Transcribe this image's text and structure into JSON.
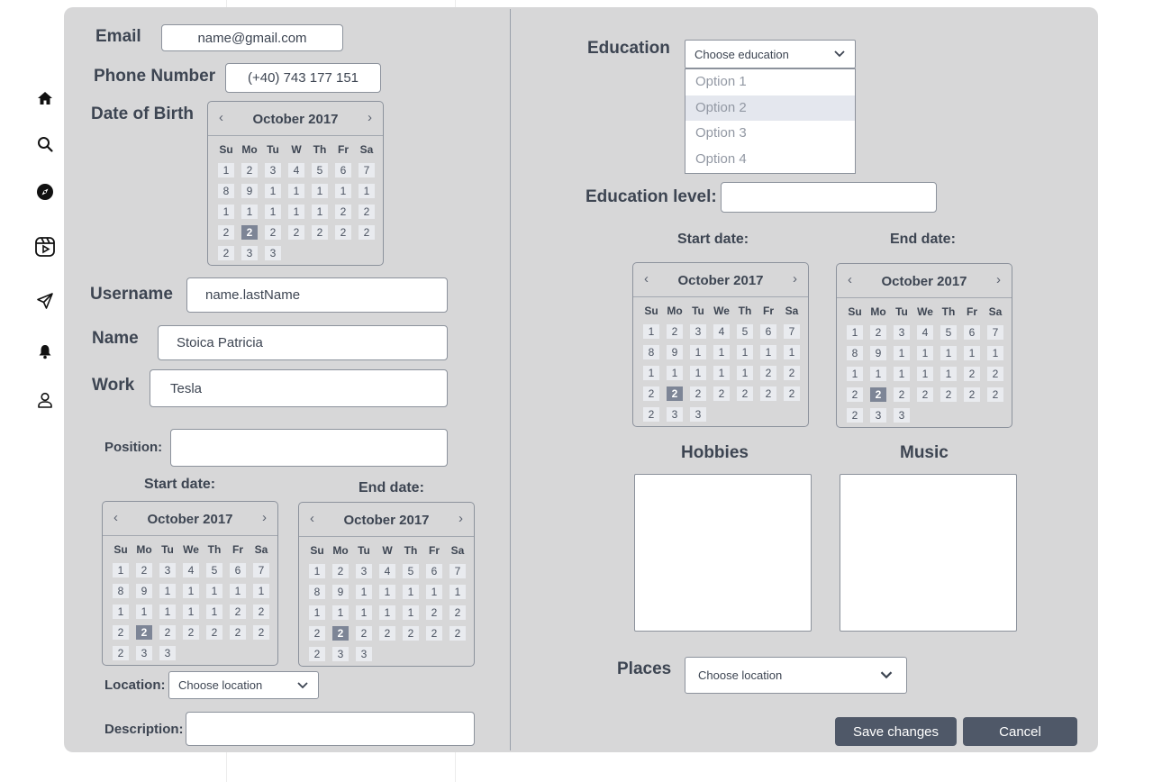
{
  "sidebar": {
    "icons": [
      "home-icon",
      "search-icon",
      "explore-icon",
      "reels-icon",
      "send-icon",
      "bell-icon",
      "profile-icon"
    ]
  },
  "form": {
    "email_label": "Email",
    "email_value": "name@gmail.com",
    "phone_label": "Phone Number",
    "phone_value": "(+40) 743 177 151",
    "dob_label": "Date of Birth",
    "username_label": "Username",
    "username_value": "name.lastName",
    "name_label": "Name",
    "name_value": "Stoica Patricia",
    "work_label": "Work",
    "work_value": "Tesla",
    "position_label": "Position:",
    "position_value": "",
    "start_date_label": "Start date:",
    "end_date_label": "End date:",
    "location_label": "Location:",
    "location_value": "Choose location",
    "description_label": "Description:",
    "description_value": "",
    "education_label": "Education",
    "education_value": "Choose education",
    "education_options": [
      "Option 1",
      "Option 2",
      "Option 3",
      "Option 4"
    ],
    "education_level_label": "Education level:",
    "education_level_value": "",
    "hobbies_label": "Hobbies",
    "music_label": "Music",
    "places_label": "Places",
    "places_value": "Choose location",
    "save_label": "Save changes",
    "cancel_label": "Cancel"
  },
  "calendar": {
    "title": "October 2017",
    "prev": "‹",
    "next": "›",
    "dows_short": [
      "Su",
      "Mo",
      "Tu",
      "W",
      "Th",
      "Fr",
      "Sa"
    ],
    "dows_long": [
      "Su",
      "Mo",
      "Tu",
      "We",
      "Th",
      "Fr",
      "Sa"
    ],
    "days": [
      "1",
      "2",
      "3",
      "4",
      "5",
      "6",
      "7",
      "8",
      "9",
      "1",
      "1",
      "1",
      "1",
      "1",
      "1",
      "1",
      "1",
      "1",
      "1",
      "2",
      "2",
      "2",
      "2",
      "2",
      "2",
      "2",
      "2",
      "2",
      "2",
      "3",
      "3"
    ],
    "selected_index": 22
  },
  "colors": {
    "panel": "#d7d7d8",
    "button": "#4f5868",
    "selected_day": "#7d8596"
  }
}
